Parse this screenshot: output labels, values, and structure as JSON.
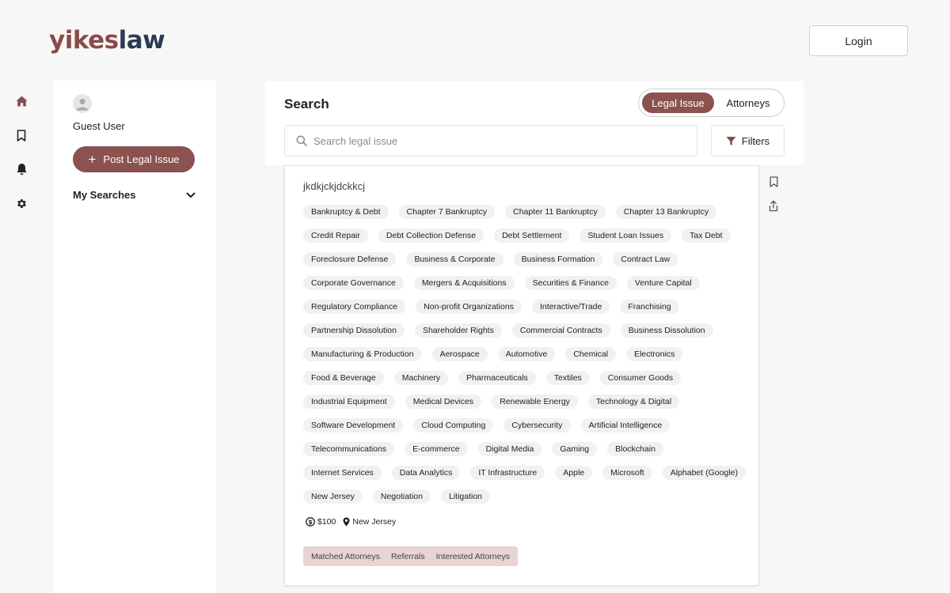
{
  "header": {
    "logo_part1": "yikes",
    "logo_part2": "law",
    "login_label": "Login"
  },
  "rail": {
    "items": [
      "home-icon",
      "bookmark-icon",
      "bell-icon",
      "gear-icon"
    ],
    "active_color": "#8b4a49"
  },
  "sidebar": {
    "user_name": "Guest User",
    "post_button_label": "Post Legal Issue",
    "my_searches_label": "My Searches"
  },
  "search": {
    "title": "Search",
    "toggle": {
      "active": "Legal Issue",
      "inactive": "Attorneys"
    },
    "placeholder": "Search legal issue",
    "filters_label": "Filters"
  },
  "result": {
    "title": "jkdkjckjdckkcj",
    "tags": [
      "Bankruptcy & Debt",
      "Chapter 7 Bankruptcy",
      "Chapter 11 Bankruptcy",
      "Chapter 13 Bankruptcy",
      "Credit Repair",
      "Debt Collection Defense",
      "Debt Settlement",
      "Student Loan Issues",
      "Tax Debt",
      "Foreclosure Defense",
      "Business & Corporate",
      "Business Formation",
      "Contract Law",
      "Corporate Governance",
      "Mergers & Acquisitions",
      "Securities & Finance",
      "Venture Capital",
      "Regulatory Compliance",
      "Non-profit Organizations",
      "Interactive/Trade",
      "Franchising",
      "Partnership Dissolution",
      "Shareholder Rights",
      "Commercial Contracts",
      "Business Dissolution",
      "Manufacturing & Production",
      "Aerospace",
      "Automotive",
      "Chemical",
      "Electronics",
      "Food & Beverage",
      "Machinery",
      "Pharmaceuticals",
      "Textiles",
      "Consumer Goods",
      "Industrial Equipment",
      "Medical Devices",
      "Renewable Energy",
      "Technology & Digital",
      "Software Development",
      "Cloud Computing",
      "Cybersecurity",
      "Artificial Intelligence",
      "Telecommunications",
      "E-commerce",
      "Digital Media",
      "Gaming",
      "Blockchain",
      "Internet Services",
      "Data Analytics",
      "IT Infrastructure",
      "Apple",
      "Microsoft",
      "Alphabet (Google)",
      "New Jersey",
      "Negotiation",
      "Litigation"
    ],
    "price": "$100",
    "location": "New Jersey",
    "subtabs": [
      "Matched Attorneys",
      "Referrals",
      "Interested Attorneys"
    ]
  },
  "colors": {
    "brand": "#8b524f",
    "logo_dark": "#2b3a55",
    "subtab_bg": "#e8d4d2"
  }
}
